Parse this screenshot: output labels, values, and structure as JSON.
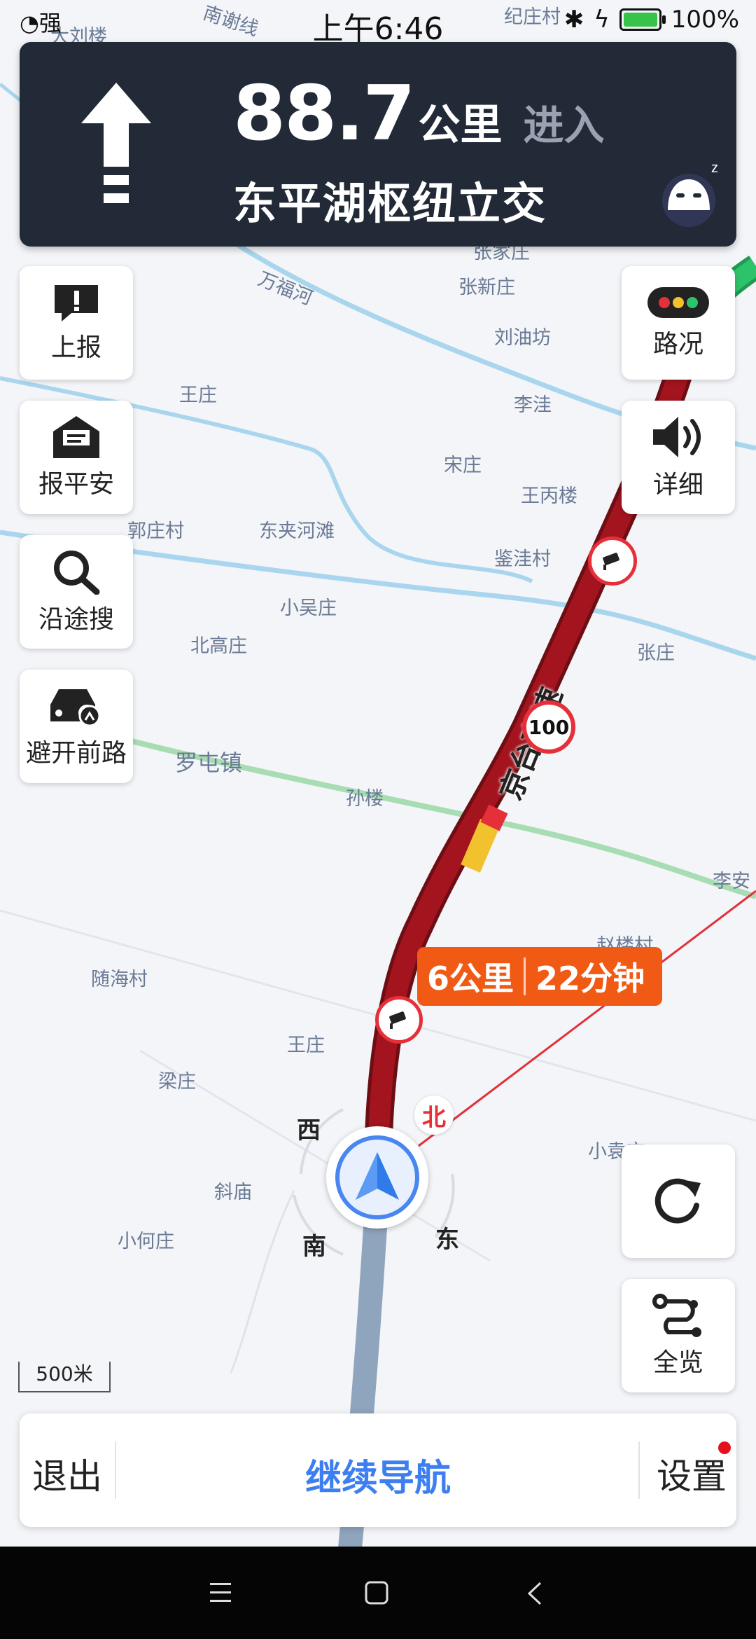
{
  "status_bar": {
    "signal_label": "强",
    "time": "上午6:46",
    "battery": "100%"
  },
  "navigation": {
    "distance_value": "88.7",
    "distance_unit": "公里",
    "action": "进入",
    "road_name": "东平湖枢纽立交"
  },
  "left_buttons": [
    {
      "label": "上报",
      "icon": "report-icon"
    },
    {
      "label": "报平安",
      "icon": "mail-icon"
    },
    {
      "label": "沿途搜",
      "icon": "search-icon"
    },
    {
      "label": "避开前路",
      "icon": "avoid-road-icon"
    }
  ],
  "right_buttons": [
    {
      "label": "路况",
      "icon": "traffic-light-icon"
    },
    {
      "label": "详细",
      "icon": "speaker-icon"
    }
  ],
  "overview_button": {
    "label": "全览",
    "icon": "route-overview-icon"
  },
  "refresh_button": {
    "icon": "refresh-icon"
  },
  "traffic_bubble": {
    "distance": "6公里",
    "time": "22分钟"
  },
  "speed_limit": "100",
  "highway_name": "京台高速",
  "compass": {
    "north": "北",
    "south": "南",
    "east": "东",
    "west": "西"
  },
  "scale": "500米",
  "bottom_bar": {
    "exit_label": "退出",
    "continue_label": "继续导航",
    "settings_label": "设置"
  },
  "map_places": [
    "南谢线",
    "大刘楼",
    "纪庄村",
    "万福河",
    "张家庄",
    "张新庄",
    "刘油坊",
    "王庄",
    "李洼",
    "宋庄",
    "王丙楼",
    "郭庄村",
    "东夹河滩",
    "鉴洼村",
    "小吴庄",
    "北高庄",
    "张庄",
    "罗屯镇",
    "孙楼",
    "李安",
    "随海村",
    "赵楼村",
    "王庄",
    "梁庄",
    "小袁庄",
    "斜庙",
    "小何庄"
  ],
  "colors": {
    "route_congested": "#a3141e",
    "route_slow": "#f2c12e",
    "route_smooth": "#2dc36a",
    "route_passed": "#8fa4bd",
    "accent": "#3d7ef0",
    "bubble": "#f05a14",
    "nav_card": "#232a37"
  }
}
